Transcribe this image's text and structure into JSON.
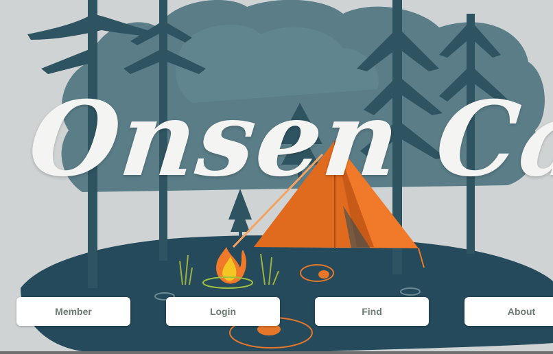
{
  "banner": {
    "title": "Onsen Camp"
  },
  "nav": {
    "buttons": [
      {
        "label": "Member"
      },
      {
        "label": "Login"
      },
      {
        "label": "Find"
      },
      {
        "label": "About"
      }
    ]
  },
  "colors": {
    "background": "#cfd3d4",
    "cloud": "#5a7d87",
    "trees": "#2f5461",
    "ground": "#244a5b",
    "tent": "#f07a2a",
    "fire": "#f5a623",
    "title_text": "#f4f4f2",
    "button_text": "#6b7b73"
  }
}
